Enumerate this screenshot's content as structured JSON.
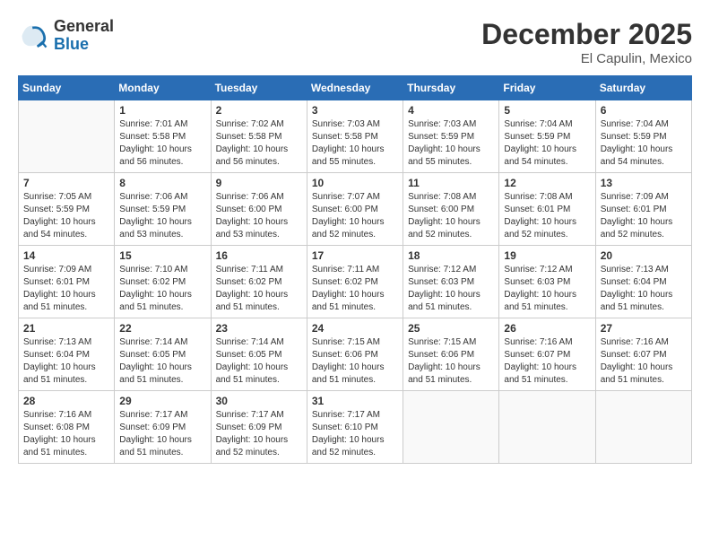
{
  "header": {
    "logo_line1": "General",
    "logo_line2": "Blue",
    "month": "December 2025",
    "location": "El Capulin, Mexico"
  },
  "weekdays": [
    "Sunday",
    "Monday",
    "Tuesday",
    "Wednesday",
    "Thursday",
    "Friday",
    "Saturday"
  ],
  "weeks": [
    [
      {
        "day": "",
        "empty": true
      },
      {
        "day": "1",
        "sunrise": "7:01 AM",
        "sunset": "5:58 PM",
        "daylight": "10 hours and 56 minutes."
      },
      {
        "day": "2",
        "sunrise": "7:02 AM",
        "sunset": "5:58 PM",
        "daylight": "10 hours and 56 minutes."
      },
      {
        "day": "3",
        "sunrise": "7:03 AM",
        "sunset": "5:58 PM",
        "daylight": "10 hours and 55 minutes."
      },
      {
        "day": "4",
        "sunrise": "7:03 AM",
        "sunset": "5:59 PM",
        "daylight": "10 hours and 55 minutes."
      },
      {
        "day": "5",
        "sunrise": "7:04 AM",
        "sunset": "5:59 PM",
        "daylight": "10 hours and 54 minutes."
      },
      {
        "day": "6",
        "sunrise": "7:04 AM",
        "sunset": "5:59 PM",
        "daylight": "10 hours and 54 minutes."
      }
    ],
    [
      {
        "day": "7",
        "sunrise": "7:05 AM",
        "sunset": "5:59 PM",
        "daylight": "10 hours and 54 minutes."
      },
      {
        "day": "8",
        "sunrise": "7:06 AM",
        "sunset": "5:59 PM",
        "daylight": "10 hours and 53 minutes."
      },
      {
        "day": "9",
        "sunrise": "7:06 AM",
        "sunset": "6:00 PM",
        "daylight": "10 hours and 53 minutes."
      },
      {
        "day": "10",
        "sunrise": "7:07 AM",
        "sunset": "6:00 PM",
        "daylight": "10 hours and 52 minutes."
      },
      {
        "day": "11",
        "sunrise": "7:08 AM",
        "sunset": "6:00 PM",
        "daylight": "10 hours and 52 minutes."
      },
      {
        "day": "12",
        "sunrise": "7:08 AM",
        "sunset": "6:01 PM",
        "daylight": "10 hours and 52 minutes."
      },
      {
        "day": "13",
        "sunrise": "7:09 AM",
        "sunset": "6:01 PM",
        "daylight": "10 hours and 52 minutes."
      }
    ],
    [
      {
        "day": "14",
        "sunrise": "7:09 AM",
        "sunset": "6:01 PM",
        "daylight": "10 hours and 51 minutes."
      },
      {
        "day": "15",
        "sunrise": "7:10 AM",
        "sunset": "6:02 PM",
        "daylight": "10 hours and 51 minutes."
      },
      {
        "day": "16",
        "sunrise": "7:11 AM",
        "sunset": "6:02 PM",
        "daylight": "10 hours and 51 minutes."
      },
      {
        "day": "17",
        "sunrise": "7:11 AM",
        "sunset": "6:02 PM",
        "daylight": "10 hours and 51 minutes."
      },
      {
        "day": "18",
        "sunrise": "7:12 AM",
        "sunset": "6:03 PM",
        "daylight": "10 hours and 51 minutes."
      },
      {
        "day": "19",
        "sunrise": "7:12 AM",
        "sunset": "6:03 PM",
        "daylight": "10 hours and 51 minutes."
      },
      {
        "day": "20",
        "sunrise": "7:13 AM",
        "sunset": "6:04 PM",
        "daylight": "10 hours and 51 minutes."
      }
    ],
    [
      {
        "day": "21",
        "sunrise": "7:13 AM",
        "sunset": "6:04 PM",
        "daylight": "10 hours and 51 minutes."
      },
      {
        "day": "22",
        "sunrise": "7:14 AM",
        "sunset": "6:05 PM",
        "daylight": "10 hours and 51 minutes."
      },
      {
        "day": "23",
        "sunrise": "7:14 AM",
        "sunset": "6:05 PM",
        "daylight": "10 hours and 51 minutes."
      },
      {
        "day": "24",
        "sunrise": "7:15 AM",
        "sunset": "6:06 PM",
        "daylight": "10 hours and 51 minutes."
      },
      {
        "day": "25",
        "sunrise": "7:15 AM",
        "sunset": "6:06 PM",
        "daylight": "10 hours and 51 minutes."
      },
      {
        "day": "26",
        "sunrise": "7:16 AM",
        "sunset": "6:07 PM",
        "daylight": "10 hours and 51 minutes."
      },
      {
        "day": "27",
        "sunrise": "7:16 AM",
        "sunset": "6:07 PM",
        "daylight": "10 hours and 51 minutes."
      }
    ],
    [
      {
        "day": "28",
        "sunrise": "7:16 AM",
        "sunset": "6:08 PM",
        "daylight": "10 hours and 51 minutes."
      },
      {
        "day": "29",
        "sunrise": "7:17 AM",
        "sunset": "6:09 PM",
        "daylight": "10 hours and 51 minutes."
      },
      {
        "day": "30",
        "sunrise": "7:17 AM",
        "sunset": "6:09 PM",
        "daylight": "10 hours and 52 minutes."
      },
      {
        "day": "31",
        "sunrise": "7:17 AM",
        "sunset": "6:10 PM",
        "daylight": "10 hours and 52 minutes."
      },
      {
        "day": "",
        "empty": true
      },
      {
        "day": "",
        "empty": true
      },
      {
        "day": "",
        "empty": true
      }
    ]
  ]
}
